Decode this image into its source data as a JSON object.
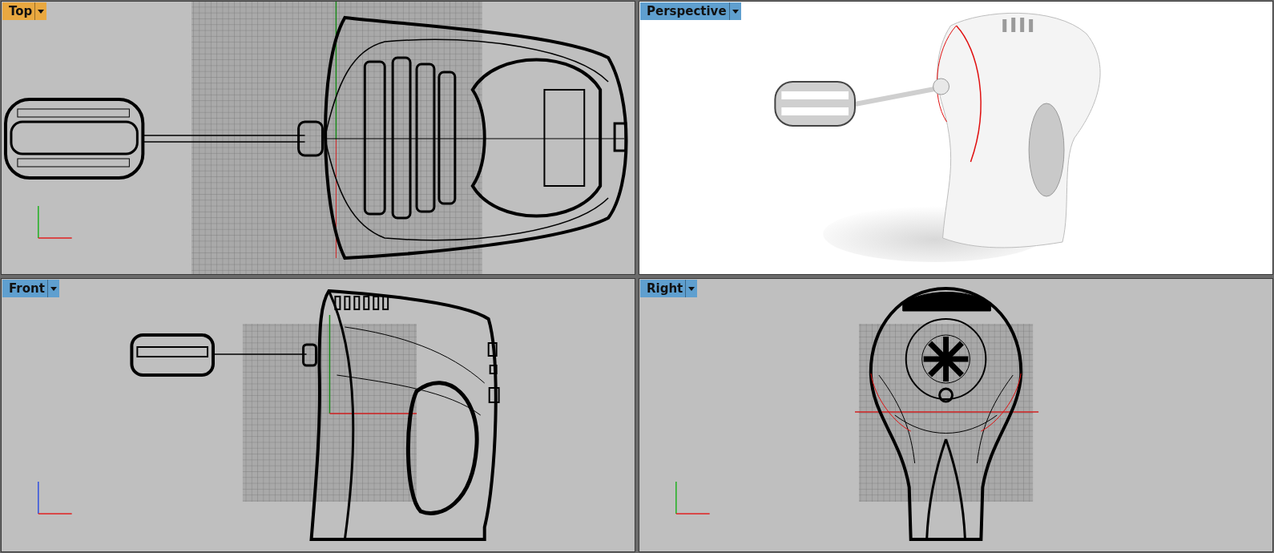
{
  "viewports": [
    {
      "title": "Top",
      "selected": true,
      "kind": "top"
    },
    {
      "title": "Perspective",
      "selected": false,
      "kind": "perspective"
    },
    {
      "title": "Front",
      "selected": false,
      "kind": "front"
    },
    {
      "title": "Right",
      "selected": false,
      "kind": "right"
    }
  ]
}
